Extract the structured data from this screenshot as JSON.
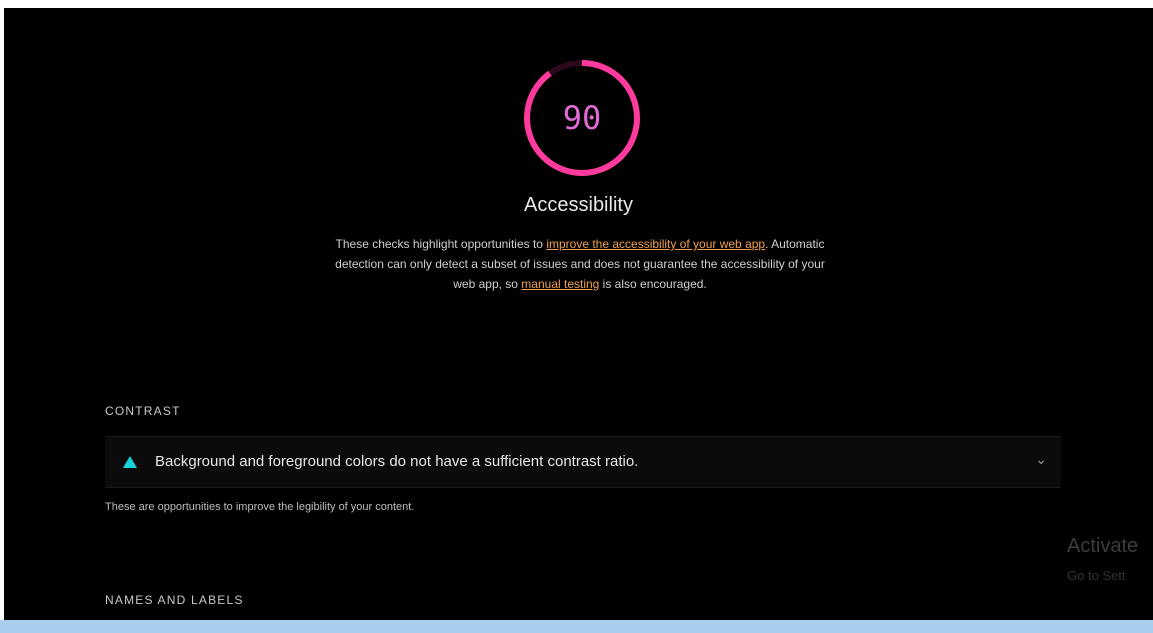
{
  "gauge": {
    "score": "90",
    "fraction": 0.9,
    "color": "#ff3a9d"
  },
  "category": {
    "title": "Accessibility",
    "description": {
      "part1": "These checks highlight opportunities to ",
      "link1": "improve the accessibility of your web app",
      "part2": ". Automatic detection can only detect a subset of issues and does not guarantee the accessibility of your web app, so ",
      "link2": "manual testing",
      "part3": " is also encouraged."
    }
  },
  "groups": {
    "contrast": {
      "title": "CONTRAST",
      "audit": {
        "title": "Background and foreground colors do not have a sufficient contrast ratio.",
        "icon": "warning-triangle-icon",
        "icon_color": "#19d3da"
      },
      "description": "These are opportunities to improve the legibility of your content."
    },
    "names_labels": {
      "title": "NAMES AND LABELS"
    }
  },
  "watermark": {
    "line1": "Activate",
    "line2": "Go to Sett"
  }
}
